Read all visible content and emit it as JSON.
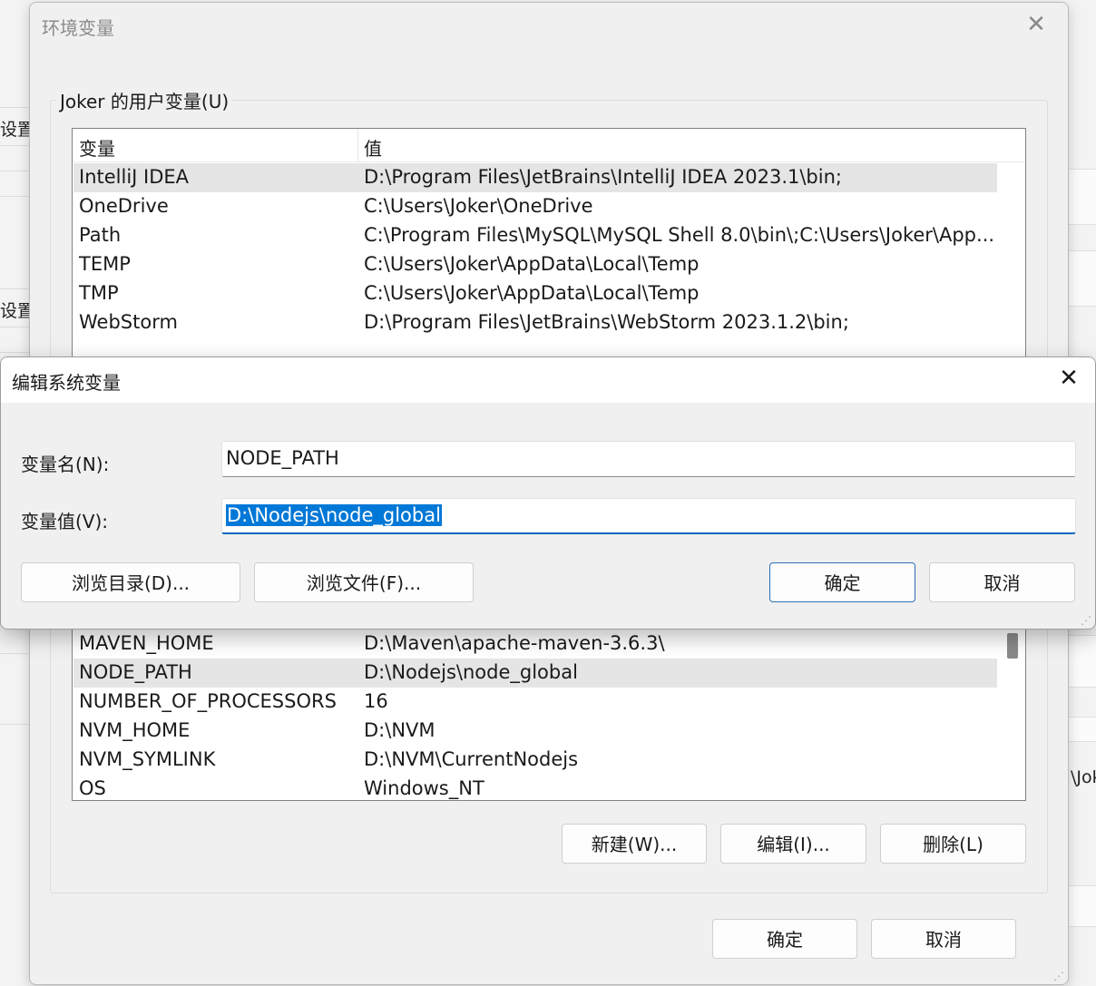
{
  "background": {
    "left_texts": [
      "设置",
      "设置"
    ],
    "right_text": "\\Jok"
  },
  "env_dialog": {
    "title": "环境变量",
    "user_group_label": "Joker 的用户变量(U)",
    "user_vars": {
      "headers": [
        "变量",
        "值"
      ],
      "rows": [
        {
          "name": "IntelliJ IDEA",
          "value": "D:\\Program Files\\JetBrains\\IntelliJ IDEA 2023.1\\bin;",
          "selected": true
        },
        {
          "name": "OneDrive",
          "value": "C:\\Users\\Joker\\OneDrive"
        },
        {
          "name": "Path",
          "value": "C:\\Program Files\\MySQL\\MySQL Shell 8.0\\bin\\;C:\\Users\\Joker\\App..."
        },
        {
          "name": "TEMP",
          "value": "C:\\Users\\Joker\\AppData\\Local\\Temp"
        },
        {
          "name": "TMP",
          "value": "C:\\Users\\Joker\\AppData\\Local\\Temp"
        },
        {
          "name": "WebStorm",
          "value": "D:\\Program Files\\JetBrains\\WebStorm 2023.1.2\\bin;"
        }
      ]
    },
    "system_vars": {
      "rows": [
        {
          "name": "MAVEN_HOME",
          "value": "D:\\Maven\\apache-maven-3.6.3\\"
        },
        {
          "name": "NODE_PATH",
          "value": "D:\\Nodejs\\node_global",
          "selected": true
        },
        {
          "name": "NUMBER_OF_PROCESSORS",
          "value": "16"
        },
        {
          "name": "NVM_HOME",
          "value": "D:\\NVM"
        },
        {
          "name": "NVM_SYMLINK",
          "value": "D:\\NVM\\CurrentNodejs"
        },
        {
          "name": "OS",
          "value": "Windows_NT"
        }
      ]
    },
    "system_buttons": {
      "new": "新建(W)...",
      "edit": "编辑(I)...",
      "delete": "删除(L)"
    },
    "ok": "确定",
    "cancel": "取消"
  },
  "edit_dialog": {
    "title": "编辑系统变量",
    "name_label": "变量名(N):",
    "name_value": "NODE_PATH",
    "value_label": "变量值(V):",
    "value_value": "D:\\Nodejs\\node_global",
    "browse_dir": "浏览目录(D)...",
    "browse_file": "浏览文件(F)...",
    "ok": "确定",
    "cancel": "取消"
  }
}
